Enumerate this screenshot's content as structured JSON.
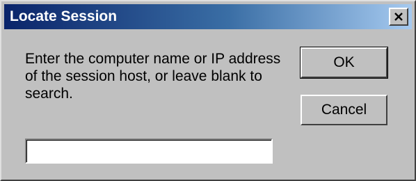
{
  "dialog": {
    "title": "Locate Session",
    "close_icon": "close-icon",
    "prompt": "Enter the computer name or IP address of the session host, or leave blank to search.",
    "host_input_value": "",
    "ok_label": "OK",
    "cancel_label": "Cancel"
  },
  "colors": {
    "titlebar_start": "#0a246a",
    "titlebar_end": "#a6caf0",
    "face": "#c0c0c0"
  }
}
